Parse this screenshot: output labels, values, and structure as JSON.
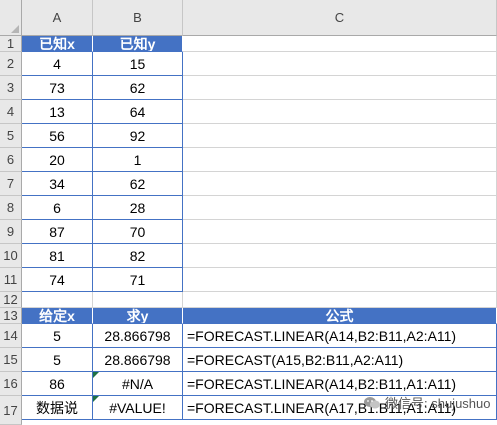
{
  "columns": [
    "A",
    "B",
    "C"
  ],
  "rows": [
    "1",
    "2",
    "3",
    "4",
    "5",
    "6",
    "7",
    "8",
    "9",
    "10",
    "11",
    "12",
    "13",
    "14",
    "15",
    "16",
    "17"
  ],
  "header1": {
    "a": "已知x",
    "b": "已知y"
  },
  "known": [
    {
      "x": "4",
      "y": "15"
    },
    {
      "x": "73",
      "y": "62"
    },
    {
      "x": "13",
      "y": "64"
    },
    {
      "x": "56",
      "y": "92"
    },
    {
      "x": "20",
      "y": "1"
    },
    {
      "x": "34",
      "y": "62"
    },
    {
      "x": "6",
      "y": "28"
    },
    {
      "x": "87",
      "y": "70"
    },
    {
      "x": "81",
      "y": "82"
    },
    {
      "x": "74",
      "y": "71"
    }
  ],
  "header13": {
    "a": "给定x",
    "b": "求y",
    "c": "公式"
  },
  "results": [
    {
      "a": "5",
      "b": "28.866798",
      "c": "=FORECAST.LINEAR(A14,B2:B11,A2:A11)"
    },
    {
      "a": "5",
      "b": "28.866798",
      "c": "=FORECAST(A15,B2:B11,A2:A11)"
    },
    {
      "a": "86",
      "b": "#N/A",
      "c": "=FORECAST.LINEAR(A14,B2:B11,A1:A11)"
    },
    {
      "a": "数据说",
      "b": "#VALUE!",
      "c": "=FORECAST.LINEAR(A17,B1:B11,A1:A11)"
    }
  ],
  "watermark": "微信号: shujushuo"
}
